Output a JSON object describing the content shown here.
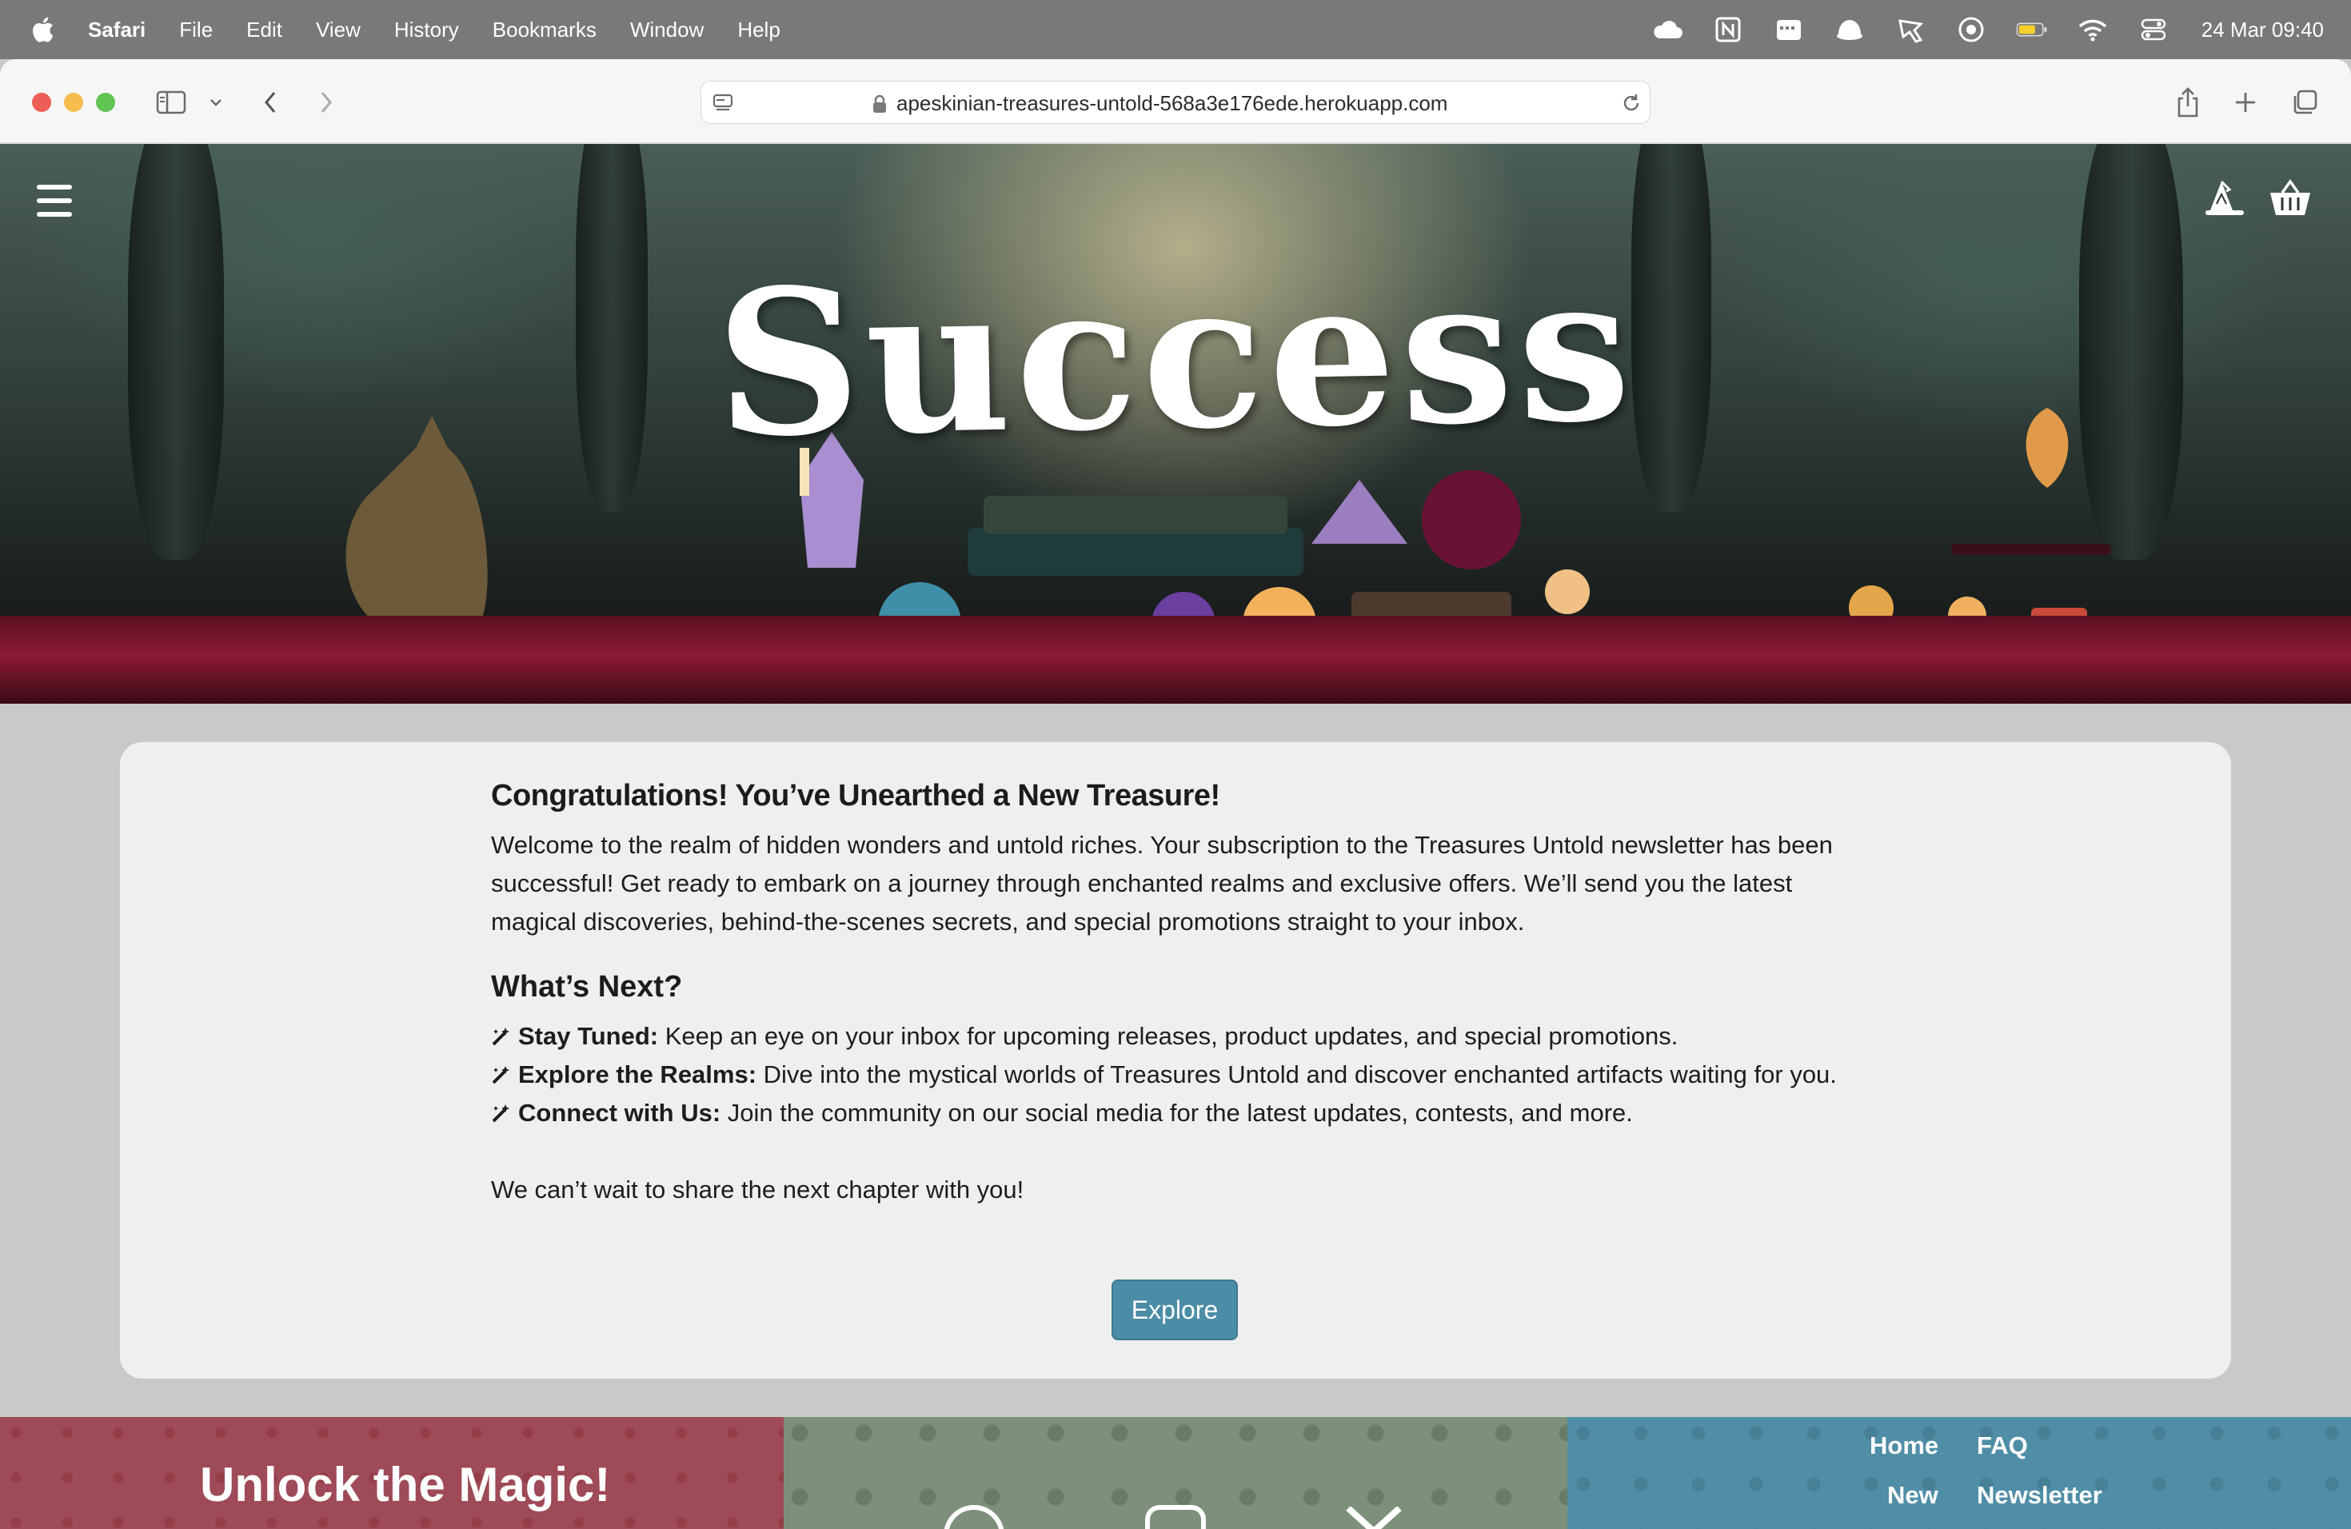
{
  "menubar": {
    "app": "Safari",
    "items": [
      "File",
      "Edit",
      "View",
      "History",
      "Bookmarks",
      "Window",
      "Help"
    ],
    "clock": "24 Mar  09:40"
  },
  "browser": {
    "url": "apeskinian-treasures-untold-568a3e176ede.herokuapp.com"
  },
  "hero": {
    "title": "Success"
  },
  "content": {
    "heading": "Congratulations! You’ve Unearthed a New Treasure!",
    "intro": "Welcome to the realm of hidden wonders and untold riches. Your subscription to the Treasures Untold newsletter has been successful! Get ready to embark on a journey through enchanted realms and exclusive offers. We’ll send you the latest magical discoveries, behind-the-scenes secrets, and special promotions straight to your inbox.",
    "next_heading": "What’s Next?",
    "items": [
      {
        "title": "Stay Tuned:",
        "text": " Keep an eye on your inbox for upcoming releases, product updates, and special promotions."
      },
      {
        "title": "Explore the Realms:",
        "text": " Dive into the mystical worlds of Treasures Untold and discover enchanted artifacts waiting for you."
      },
      {
        "title": "Connect with Us:",
        "text": " Join the community on our social media for the latest updates, contests, and more."
      }
    ],
    "closing": "We can’t wait to share the next chapter with you!",
    "button": "Explore"
  },
  "footer": {
    "tagline": "Unlock the Magic!",
    "links": [
      "Home",
      "FAQ",
      "New",
      "Newsletter"
    ]
  },
  "colors": {
    "button": "#4b8da6",
    "footer_left": "#9f4a57",
    "footer_middle": "#7d917a",
    "footer_right": "#4f8ea6"
  }
}
